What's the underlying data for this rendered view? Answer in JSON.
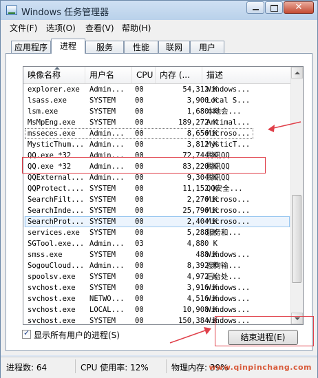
{
  "window": {
    "title": "Windows 任务管理器"
  },
  "menu": [
    "文件(F)",
    "选项(O)",
    "查看(V)",
    "帮助(H)"
  ],
  "tabs": [
    {
      "label": "应用程序",
      "active": false
    },
    {
      "label": "进程",
      "active": true
    },
    {
      "label": "服务",
      "active": false
    },
    {
      "label": "性能",
      "active": false
    },
    {
      "label": "联网",
      "active": false
    },
    {
      "label": "用户",
      "active": false
    }
  ],
  "table": {
    "headers": [
      "映像名称",
      "用户名",
      "CPU",
      "内存 (...",
      "描述"
    ],
    "rows": [
      {
        "name": "explorer.exe",
        "user": "Admin...",
        "cpu": "00",
        "mem": "54,312 K",
        "desc": "Windows..."
      },
      {
        "name": "lsass.exe",
        "user": "SYSTEM",
        "cpu": "00",
        "mem": "3,900 K",
        "desc": "Local S..."
      },
      {
        "name": "lsm.exe",
        "user": "SYSTEM",
        "cpu": "00",
        "mem": "1,680 K",
        "desc": "本地会..."
      },
      {
        "name": "MsMpEng.exe",
        "user": "SYSTEM",
        "cpu": "00",
        "mem": "189,272 K",
        "desc": "Antimal..."
      },
      {
        "name": "msseces.exe",
        "user": "Admin...",
        "cpu": "00",
        "mem": "8,656 K",
        "desc": "Microso..."
      },
      {
        "name": "MysticThum...",
        "user": "Admin...",
        "cpu": "00",
        "mem": "3,812 K",
        "desc": "MysticT..."
      },
      {
        "name": "QQ.exe *32",
        "user": "Admin...",
        "cpu": "00",
        "mem": "72,744 K",
        "desc": "腾讯QQ"
      },
      {
        "name": "QQ.exe *32",
        "user": "Admin...",
        "cpu": "00",
        "mem": "83,220 K",
        "desc": "腾讯QQ"
      },
      {
        "name": "QQExternal...",
        "user": "Admin...",
        "cpu": "00",
        "mem": "9,304 K",
        "desc": "腾讯QQ"
      },
      {
        "name": "QQProtect....",
        "user": "SYSTEM",
        "cpu": "00",
        "mem": "11,152 K",
        "desc": "QQ安全..."
      },
      {
        "name": "SearchFilt...",
        "user": "SYSTEM",
        "cpu": "00",
        "mem": "2,276 K",
        "desc": "Microso..."
      },
      {
        "name": "SearchInde...",
        "user": "SYSTEM",
        "cpu": "00",
        "mem": "25,796 K",
        "desc": "Microso..."
      },
      {
        "name": "SearchProt...",
        "user": "SYSTEM",
        "cpu": "00",
        "mem": "2,404 K",
        "desc": "Microso..."
      },
      {
        "name": "services.exe",
        "user": "SYSTEM",
        "cpu": "00",
        "mem": "5,288 K",
        "desc": "服务和..."
      },
      {
        "name": "SGTool.exe...",
        "user": "Admin...",
        "cpu": "03",
        "mem": "4,880 K",
        "desc": ""
      },
      {
        "name": "smss.exe",
        "user": "SYSTEM",
        "cpu": "00",
        "mem": "488 K",
        "desc": "Windows..."
      },
      {
        "name": "SogouCloud...",
        "user": "Admin...",
        "cpu": "00",
        "mem": "8,392 K",
        "desc": "搜狗输..."
      },
      {
        "name": "spoolsv.exe",
        "user": "SYSTEM",
        "cpu": "00",
        "mem": "4,972 K",
        "desc": "后台处..."
      },
      {
        "name": "svchost.exe",
        "user": "SYSTEM",
        "cpu": "00",
        "mem": "3,916 K",
        "desc": "Windows..."
      },
      {
        "name": "svchost.exe",
        "user": "NETWO...",
        "cpu": "00",
        "mem": "4,516 K",
        "desc": "Windows..."
      },
      {
        "name": "svchost.exe",
        "user": "LOCAL...",
        "cpu": "00",
        "mem": "10,908 K",
        "desc": "Windows..."
      },
      {
        "name": "svchost.exe",
        "user": "SYSTEM",
        "cpu": "00",
        "mem": "150,384 K",
        "desc": "Windows..."
      }
    ],
    "selected_index": 12,
    "focused_index": 4
  },
  "show_all_users": {
    "label": "显示所有用户的进程(S)",
    "checked": true
  },
  "end_process_button": "结束进程(E)",
  "status": {
    "processes": "进程数: 64",
    "cpu": "CPU 使用率: 12%",
    "memory": "物理内存: 39%"
  },
  "watermark": "www.qinpinchang.com",
  "colors": {
    "highlight": "#e0404a",
    "selection": "#99c7f0"
  }
}
